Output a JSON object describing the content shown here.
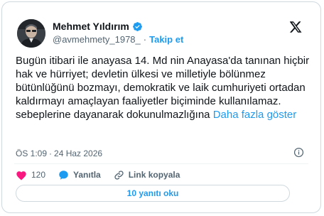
{
  "author": {
    "display_name": "Mehmet Yıldırım",
    "handle": "@avmehmety_1978_",
    "separator": "·",
    "follow_label": "Takip et"
  },
  "tweet": {
    "text_main": "Bugün itibari ile anayasa 14. Md nin Anayasa'da tanınan hiçbir hak ve hürriyet; devletin ülkesi ve milletiyle bölünmez bütünlüğünü bozmayı, demokratik ve laik cumhuriyeti ortadan kaldırmayı amaçlayan faaliyetler biçiminde kullanılamaz.",
    "text_second": "sebeplerine dayanarak dokunulmazlığına ",
    "show_more": "Daha fazla göster",
    "time": "ÖS 1:09",
    "date_separator": "·",
    "date": "24 Haz 2026"
  },
  "actions": {
    "like_count": "120",
    "reply_label": "Yanıtla",
    "copy_link_label": "Link kopyala"
  },
  "read_replies_label": "10 yanıtı oku",
  "colors": {
    "accent": "#1d9bf0",
    "like": "#f91880",
    "verified": "#1d9bf0",
    "secondary_text": "#536471",
    "border": "#cfd9de"
  },
  "icons": {
    "verified": "verified-badge-icon",
    "logo": "x-logo-icon",
    "info": "info-icon",
    "like": "heart-icon",
    "reply": "speech-bubble-icon",
    "link": "link-icon"
  }
}
